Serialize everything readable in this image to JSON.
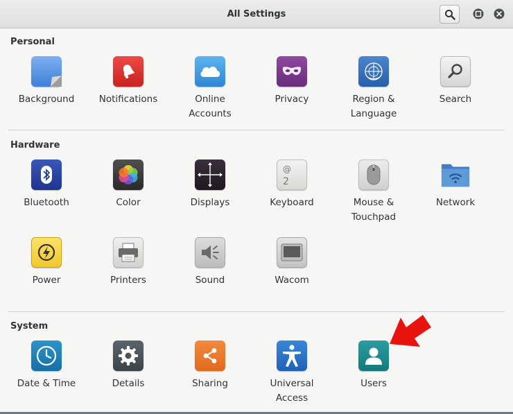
{
  "window": {
    "title": "All Settings"
  },
  "sections": {
    "personal": {
      "title": "Personal",
      "items": [
        {
          "label": "Background"
        },
        {
          "label": "Notifications"
        },
        {
          "label": "Online\nAccounts"
        },
        {
          "label": "Privacy"
        },
        {
          "label": "Region &\nLanguage"
        },
        {
          "label": "Search"
        }
      ]
    },
    "hardware": {
      "title": "Hardware",
      "items": [
        {
          "label": "Bluetooth"
        },
        {
          "label": "Color"
        },
        {
          "label": "Displays"
        },
        {
          "label": "Keyboard"
        },
        {
          "label": "Mouse &\nTouchpad"
        },
        {
          "label": "Network"
        },
        {
          "label": "Power"
        },
        {
          "label": "Printers"
        },
        {
          "label": "Sound"
        },
        {
          "label": "Wacom"
        }
      ]
    },
    "system": {
      "title": "System",
      "items": [
        {
          "label": "Date & Time"
        },
        {
          "label": "Details"
        },
        {
          "label": "Sharing"
        },
        {
          "label": "Universal\nAccess"
        },
        {
          "label": "Users"
        }
      ]
    }
  },
  "icons": {
    "background": "background-icon",
    "notifications": "bell-icon",
    "online_accounts": "cloud-icon",
    "privacy": "mask-icon",
    "region": "globe-icon",
    "search": "magnifier-icon",
    "bluetooth": "bluetooth-icon",
    "color": "color-wheel-icon",
    "displays": "displays-icon",
    "keyboard": "keyboard-key-icon",
    "mouse": "mouse-icon",
    "network": "network-folder-icon",
    "power": "power-icon",
    "printers": "printer-icon",
    "sound": "speaker-icon",
    "wacom": "tablet-icon",
    "datetime": "clock-icon",
    "details": "gear-icon",
    "sharing": "share-icon",
    "universal_access": "accessibility-icon",
    "users": "user-icon"
  },
  "colors": {
    "accent_arrow": "#e8140f",
    "notifications": "#d9302d",
    "privacy": "#7a3a8c",
    "users": "#1f8a8e"
  }
}
